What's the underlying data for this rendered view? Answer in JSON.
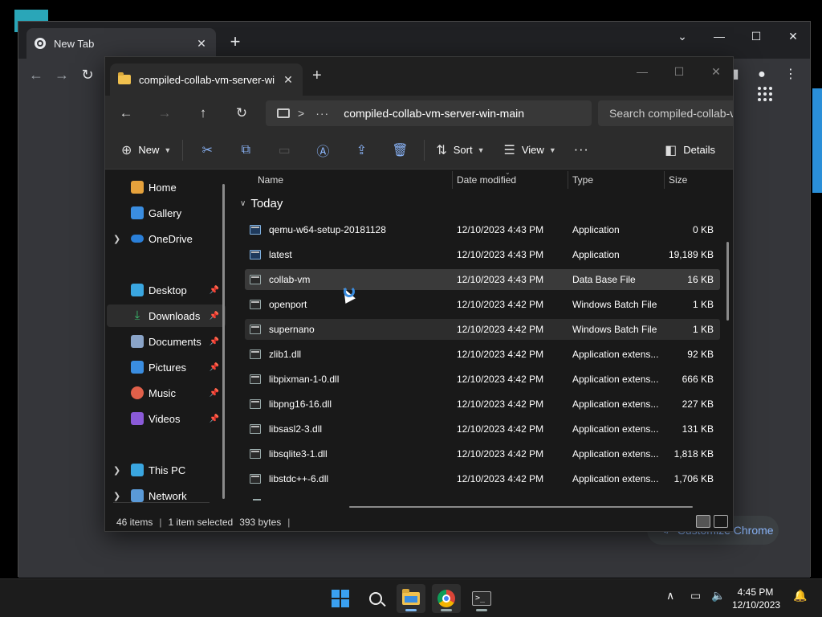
{
  "chrome": {
    "tab_title": "New Tab",
    "new_tab_glyph": "+",
    "close_glyph": "✕",
    "window_controls": {
      "tabs_list": "⌄",
      "minimize": "—",
      "maximize": "☐",
      "close": "✕"
    },
    "customize_label": "Customize Chrome",
    "icons": [
      "chrome-favicon",
      "back-icon",
      "forward-icon",
      "reload-icon",
      "sidepanel-icon",
      "profile-icon",
      "menu-icon",
      "labs-icon",
      "apps-icon",
      "pen-icon"
    ]
  },
  "explorer": {
    "tab_title": "compiled-collab-vm-server-wi",
    "address": {
      "separator": ">",
      "ellipsis": "···",
      "path": "compiled-collab-vm-server-win-main"
    },
    "search_placeholder": "Search compiled-collab-vm-server-win-main",
    "commands": {
      "new_label": "New",
      "sort_label": "Sort",
      "view_label": "View",
      "more_label": "···",
      "details_label": "Details"
    },
    "nav": {
      "home": "Home",
      "gallery": "Gallery",
      "onedrive": "OneDrive",
      "desktop": "Desktop",
      "downloads": "Downloads",
      "documents": "Documents",
      "pictures": "Pictures",
      "music": "Music",
      "videos": "Videos",
      "this_pc": "This PC",
      "network": "Network"
    },
    "columns": {
      "name": "Name",
      "date": "Date modified",
      "type": "Type",
      "size": "Size"
    },
    "group_label": "Today",
    "files": [
      {
        "name": "qemu-w64-setup-20181128",
        "date": "12/10/2023 4:43 PM",
        "type": "Application",
        "size": "0 KB"
      },
      {
        "name": "latest",
        "date": "12/10/2023 4:43 PM",
        "type": "Application",
        "size": "19,189 KB"
      },
      {
        "name": "collab-vm",
        "date": "12/10/2023 4:43 PM",
        "type": "Data Base File",
        "size": "16 KB"
      },
      {
        "name": "openport",
        "date": "12/10/2023 4:42 PM",
        "type": "Windows Batch File",
        "size": "1 KB"
      },
      {
        "name": "supernano",
        "date": "12/10/2023 4:42 PM",
        "type": "Windows Batch File",
        "size": "1 KB"
      },
      {
        "name": "zlib1.dll",
        "date": "12/10/2023 4:42 PM",
        "type": "Application extens...",
        "size": "92 KB"
      },
      {
        "name": "libpixman-1-0.dll",
        "date": "12/10/2023 4:42 PM",
        "type": "Application extens...",
        "size": "666 KB"
      },
      {
        "name": "libpng16-16.dll",
        "date": "12/10/2023 4:42 PM",
        "type": "Application extens...",
        "size": "227 KB"
      },
      {
        "name": "libsasl2-3.dll",
        "date": "12/10/2023 4:42 PM",
        "type": "Application extens...",
        "size": "131 KB"
      },
      {
        "name": "libsqlite3-1.dll",
        "date": "12/10/2023 4:42 PM",
        "type": "Application extens...",
        "size": "1,818 KB"
      },
      {
        "name": "libstdc++-6.dll",
        "date": "12/10/2023 4:42 PM",
        "type": "Application extens...",
        "size": "1,706 KB"
      }
    ],
    "status": {
      "item_count": "46 items",
      "selection": "1 item selected",
      "selection_size": "393 bytes"
    }
  },
  "taskbar": {
    "time": "4:45 PM",
    "date": "12/10/2023",
    "apps": [
      "start",
      "search",
      "file-explorer",
      "chrome",
      "terminal"
    ]
  },
  "colors": {
    "accent": "#3a8de0",
    "chrome_link": "#8ab4f8",
    "folder": "#f1c14e",
    "explorer_bg": "#191919",
    "chrome_bg": "#35363a"
  }
}
